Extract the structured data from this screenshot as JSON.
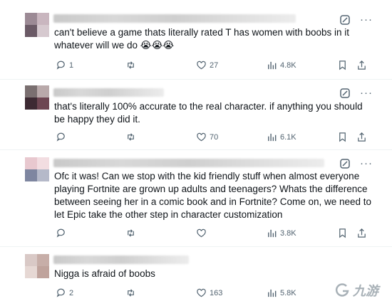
{
  "posts": [
    {
      "text": "can't believe a game thats literally rated T has women with boobs in it whatever will we do 😭😭😭",
      "replies": "1",
      "retweets": "",
      "likes": "27",
      "views": "4.8K",
      "avatar_colors": [
        "#9c8a95",
        "#c9b6bf",
        "#6b5a66",
        "#d6c9cf"
      ]
    },
    {
      "text": "that's literally 100% accurate to the real character. if anything you should be happy they did it.",
      "replies": "",
      "retweets": "",
      "likes": "70",
      "views": "6.1K",
      "avatar_colors": [
        "#7a6f70",
        "#b9a9aa",
        "#3d2a33",
        "#6e4652"
      ]
    },
    {
      "text": "Ofc it was! Can we stop with the kid friendly stuff when almost everyone playing Fortnite are grown up adults and teenagers? Whats the difference between seeing her in a comic book and in Fortnite? Come on, we need to let Epic take the other step in character customization",
      "replies": "",
      "retweets": "",
      "likes": "",
      "views": "3.8K",
      "avatar_colors": [
        "#e8c8cf",
        "#f2dde1",
        "#7e86a0",
        "#b5b9c9"
      ]
    },
    {
      "text": "Nigga is afraid of boobs",
      "replies": "2",
      "retweets": "",
      "likes": "163",
      "views": "5.8K",
      "avatar_colors": [
        "#d9c9c6",
        "#c7aea8",
        "#e6d8d4",
        "#bfa39c"
      ]
    }
  ],
  "watermark": {
    "text": "九游",
    "icon": "g-logo-icon"
  },
  "icons": [
    "reply-icon",
    "retweet-icon",
    "like-icon",
    "views-icon",
    "bookmark-icon",
    "share-icon",
    "grok-icon",
    "more-icon"
  ]
}
